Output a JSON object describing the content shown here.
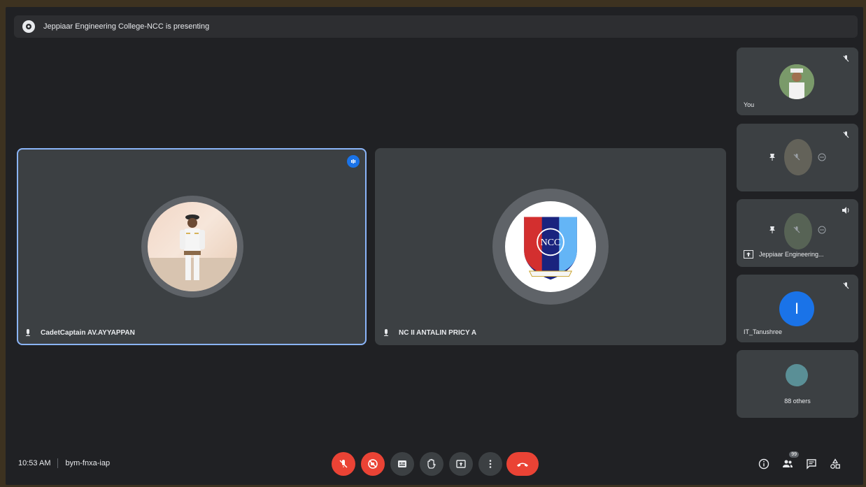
{
  "presenting_bar": {
    "text": "Jeppiaar Engineering College-NCC is presenting"
  },
  "main_tiles": [
    {
      "name": "CadetCaptain AV.AYYAPPAN"
    },
    {
      "name": "NC II ANTALIN PRICY A"
    }
  ],
  "ncc_logo_text": "NCC",
  "side_tiles": [
    {
      "label": "You"
    },
    {
      "label": ""
    },
    {
      "label": "Jeppiaar Engineering..."
    },
    {
      "label": "IT_Tanushree",
      "initial": "I"
    },
    {
      "label": "88 others"
    }
  ],
  "bottom": {
    "time": "10:53 AM",
    "meeting_code": "bym-fnxa-iap",
    "people_count": "99"
  },
  "colors": {
    "background": "#202124",
    "tile": "#3c4043",
    "red": "#ea4335",
    "blue_accent": "#8ab4f8",
    "initial_avatar": "#1a73e8"
  }
}
